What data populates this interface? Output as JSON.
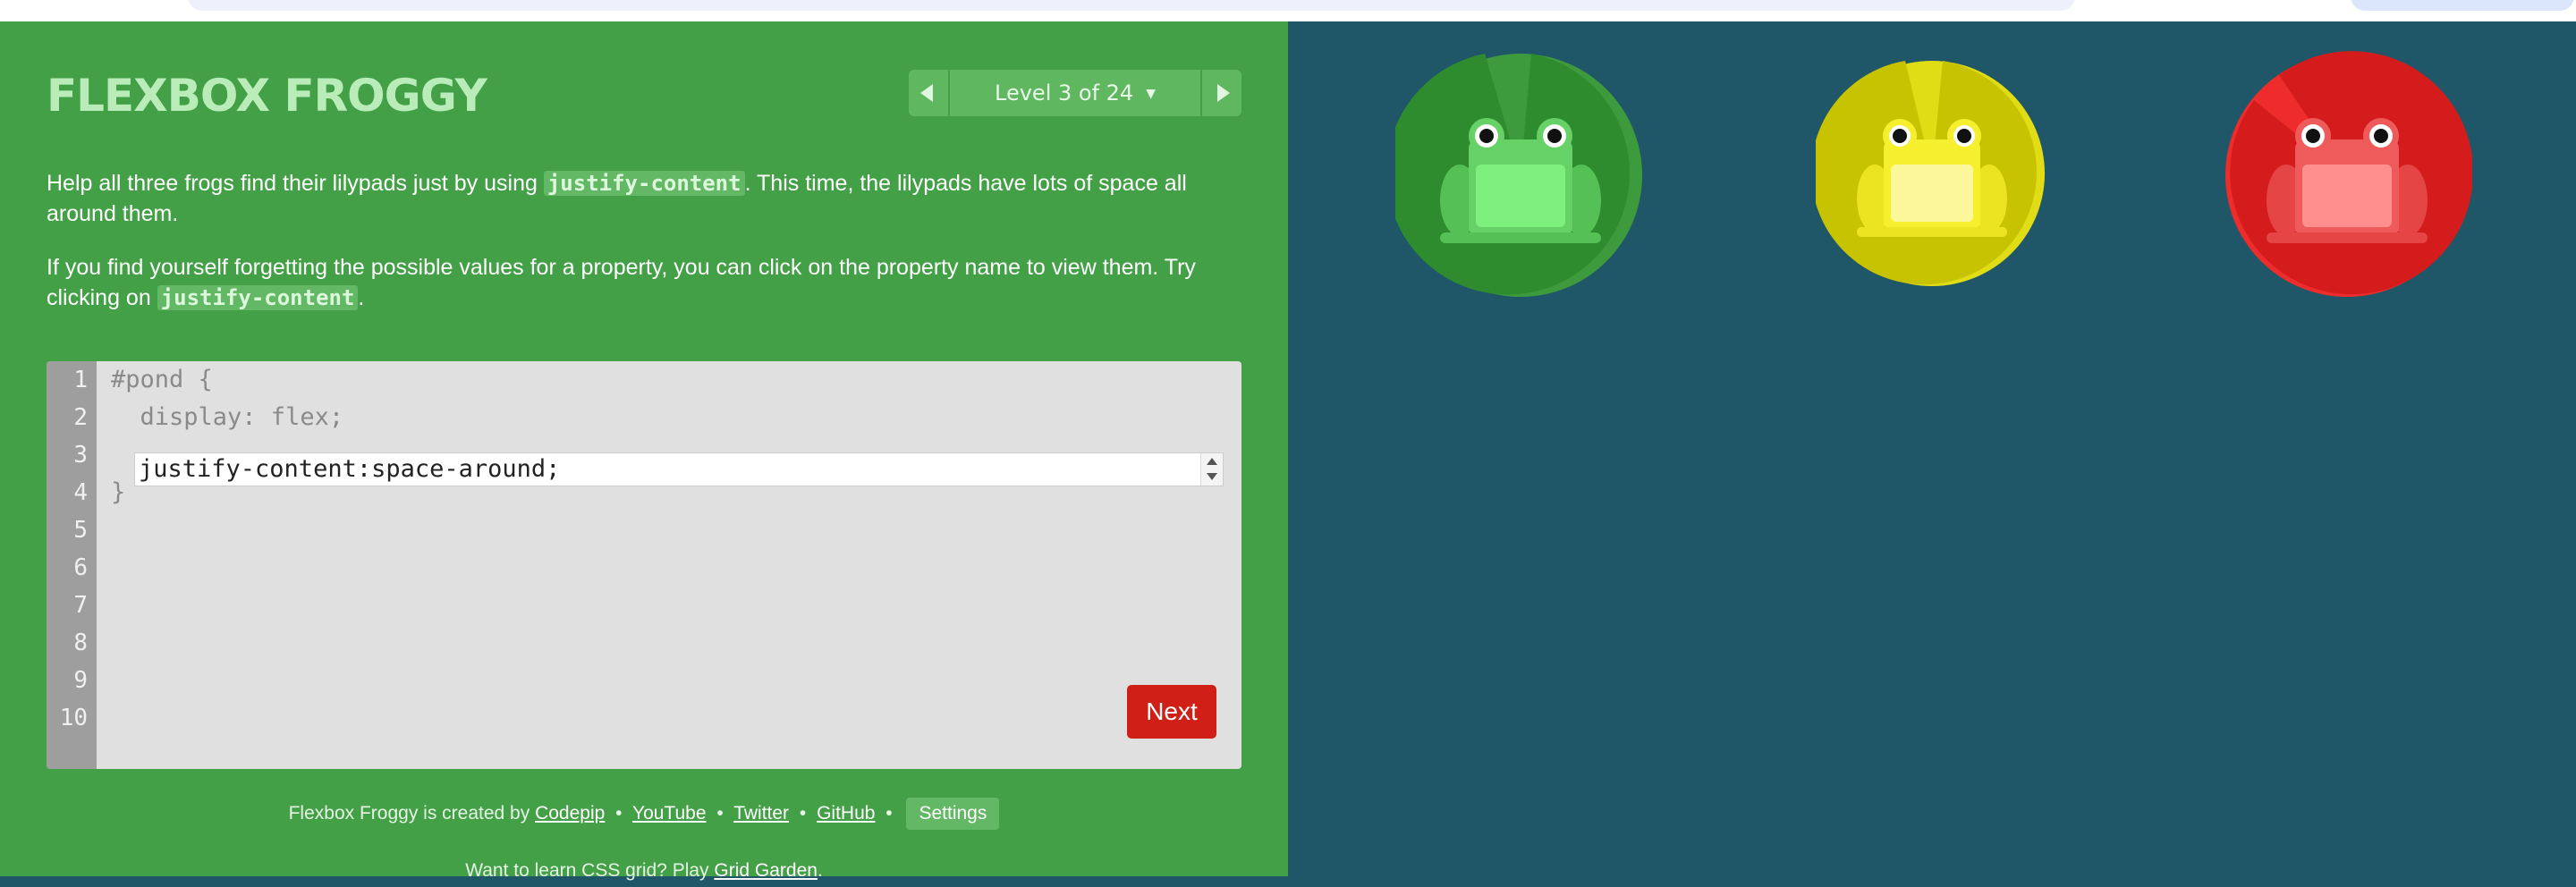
{
  "header": {
    "title": "Flexbox Froggy",
    "level_label": "Level 3 of 24",
    "caret": "▼"
  },
  "instructions": {
    "p1_before": "Help all three frogs find their lilypads just by using ",
    "p1_code": "justify-content",
    "p1_after": ". This time, the lilypads have lots of space all around them.",
    "p2_before": "If you find yourself forgetting the possible values for a property, you can click on the property name to view them. Try clicking on ",
    "p2_code": "justify-content",
    "p2_after": "."
  },
  "editor": {
    "line_numbers": [
      "1",
      "2",
      "3",
      "4",
      "5",
      "6",
      "7",
      "8",
      "9",
      "10"
    ],
    "line1": "#pond {",
    "line2": "  display: flex;",
    "line4": "}",
    "input_value": "justify-content:space-around;",
    "next_label": "Next"
  },
  "footer": {
    "credit_prefix": "Flexbox Froggy is created by",
    "links": [
      "Codepip",
      "YouTube",
      "Twitter",
      "GitHub"
    ],
    "separator": "•",
    "settings_label": "Settings",
    "grid_prefix": "Want to learn CSS grid? Play",
    "grid_link": "Grid Garden",
    "grid_suffix": "."
  },
  "pond": {
    "frogs": [
      {
        "color": "green",
        "pad": "#2e8b2e",
        "body": "#66d166"
      },
      {
        "color": "yellow",
        "pad": "#c7c300",
        "body": "#f5ef2d"
      },
      {
        "color": "red",
        "pad": "#d41c1c",
        "body": "#ef5a5a"
      }
    ]
  },
  "colors": {
    "left_panel": "#43a047",
    "right_panel": "#1f5768",
    "next_button": "#d01f16"
  }
}
